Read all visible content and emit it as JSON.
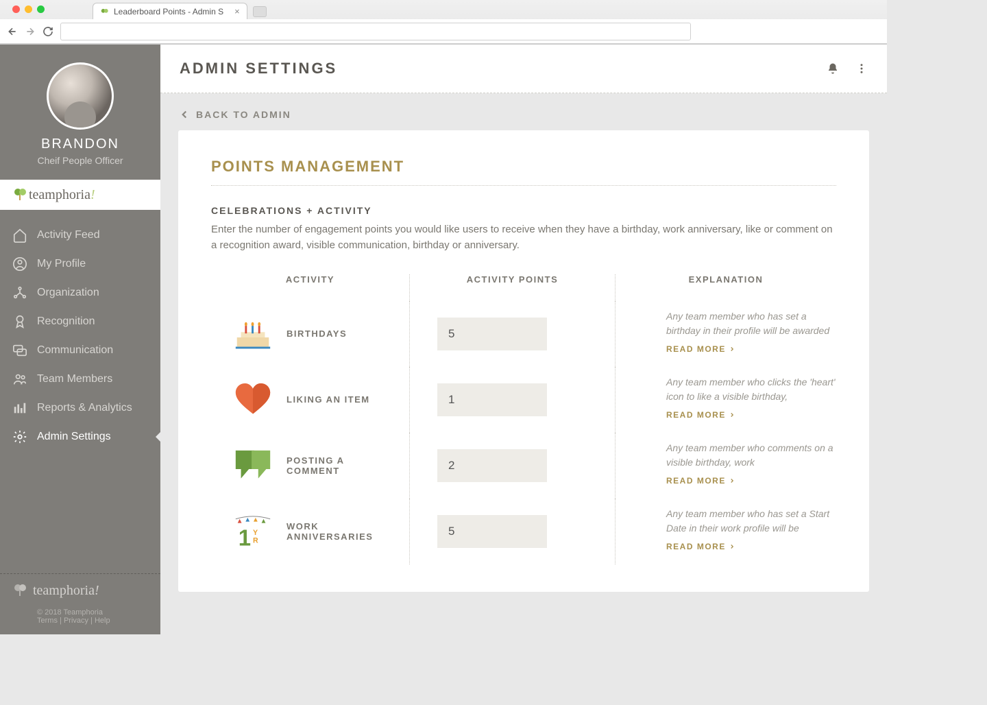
{
  "browser": {
    "tab_title": "Leaderboard Points - Admin S"
  },
  "user": {
    "name": "BRANDON",
    "role": "Cheif People Officer"
  },
  "brand": "teamphoria",
  "sidebar": {
    "items": [
      {
        "label": "Activity Feed",
        "icon": "home"
      },
      {
        "label": "My Profile",
        "icon": "profile"
      },
      {
        "label": "Organization",
        "icon": "org"
      },
      {
        "label": "Recognition",
        "icon": "award"
      },
      {
        "label": "Communication",
        "icon": "chat"
      },
      {
        "label": "Team Members",
        "icon": "team"
      },
      {
        "label": "Reports & Analytics",
        "icon": "bars"
      },
      {
        "label": "Admin Settings",
        "icon": "gear"
      }
    ],
    "active_index": 7
  },
  "footer": {
    "copyright": "© 2018 Teamphoria",
    "links": [
      "Terms",
      "Privacy",
      "Help"
    ]
  },
  "page": {
    "title": "ADMIN SETTINGS",
    "back_label": "BACK TO ADMIN"
  },
  "points": {
    "card_title": "POINTS MANAGEMENT",
    "section_label": "CELEBRATIONS + ACTIVITY",
    "section_desc": "Enter the number of engagement points you would like users to receive when they have a birthday, work anniversary, like or comment on a recognition award, visible communication, birthday or anniversary.",
    "col_activity": "ACTIVITY",
    "col_points": "ACTIVITY POINTS",
    "col_explanation": "EXPLANATION",
    "read_more": "READ MORE",
    "rows": [
      {
        "label": "BIRTHDAYS",
        "value": "5",
        "explanation": "Any team member who has set a birthday in their profile will be awarded",
        "icon": "cake"
      },
      {
        "label": "LIKING AN ITEM",
        "value": "1",
        "explanation": "Any team member who clicks the 'heart' icon to like a visible birthday,",
        "icon": "heart"
      },
      {
        "label": "POSTING A COMMENT",
        "value": "2",
        "explanation": "Any team member who comments on a visible birthday, work",
        "icon": "comment"
      },
      {
        "label": "WORK ANNIVERSARIES",
        "value": "5",
        "explanation": "Any team member who has set a Start Date in their work profile will be",
        "icon": "anniversary"
      }
    ]
  }
}
